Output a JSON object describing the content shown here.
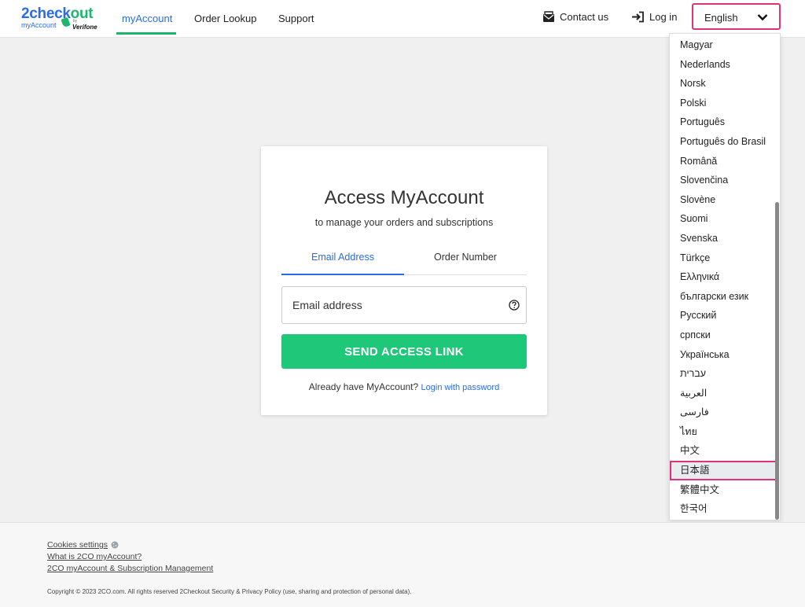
{
  "header": {
    "logo": {
      "main_a": "2check",
      "main_b": "out",
      "sub": "myAccount",
      "by": "by",
      "brand": "Verifone"
    },
    "nav": {
      "myaccount": "myAccount",
      "order_lookup": "Order Lookup",
      "support": "Support"
    },
    "contact": "Contact us",
    "login": "Log in",
    "language": "English"
  },
  "languages": [
    "Magyar",
    "Nederlands",
    "Norsk",
    "Polski",
    "Português",
    "Português do Brasil",
    "Română",
    "Slovenčina",
    "Slovène",
    "Suomi",
    "Svenska",
    "Türkçe",
    "Ελληνικά",
    "български език",
    "Русский",
    "српски",
    "Українська",
    "עברית",
    "العربية",
    "فارسی",
    "ไทย",
    "中文",
    "日本語",
    "繁體中文",
    "한국어"
  ],
  "selected_language_index": 22,
  "card": {
    "title": "Access MyAccount",
    "subtitle": "to manage your orders and subscriptions",
    "tab_email": "Email Address",
    "tab_order": "Order Number",
    "email_placeholder": "Email address",
    "send_button": "SEND ACCESS LINK",
    "already": "Already have MyAccount?",
    "login_password": "Login with password"
  },
  "footer": {
    "cookies": "Cookies settings",
    "what_is": "What is 2CO myAccount?",
    "management": "2CO myAccount & Subscription Management",
    "copyright": "Copyright © 2023 2CO.com. All rights reserved 2Checkout Security & Privacy Policy (use, sharing and protection of personal data)."
  },
  "colors": {
    "brand_blue": "#2b6be3",
    "brand_green": "#1fb56f",
    "button_green": "#1ec878",
    "highlight_pink": "#e0327a"
  }
}
